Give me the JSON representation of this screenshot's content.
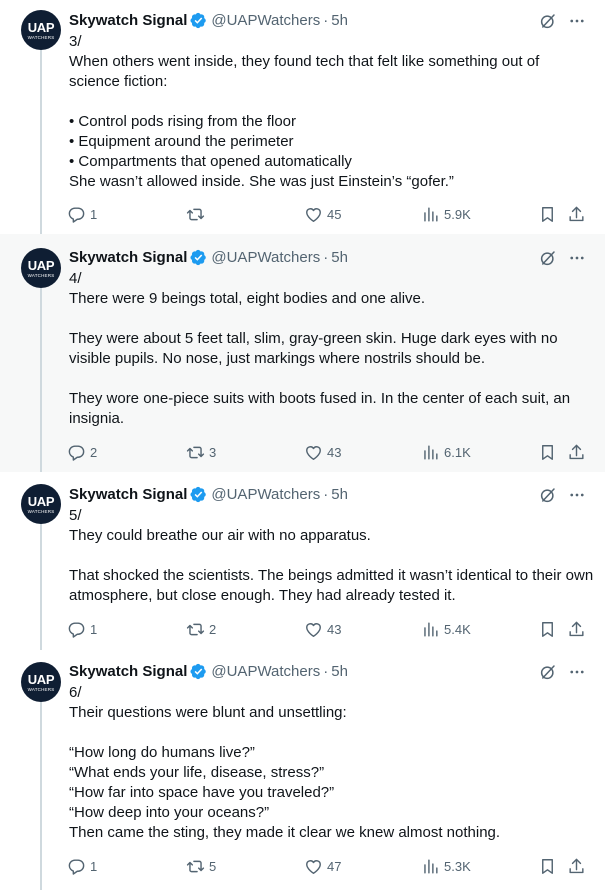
{
  "author": {
    "name": "Skywatch Signal",
    "handle": "@UAPWatchers",
    "separator": "·",
    "avatar_text": "UAP",
    "avatar_subtext": "WATCHERS",
    "verified_icon": "verified-badge-icon"
  },
  "colors": {
    "verified": "#1d9bf0",
    "muted": "#536471",
    "text": "#0f1419",
    "highlight_bg": "#f7f8f8",
    "thread_line": "#cfd9de",
    "avatar_bg": "#0f1e33"
  },
  "tweets": [
    {
      "time": "5h",
      "text": "3/\nWhen others went inside, they found tech that felt like something out of science fiction:\n\n• Control pods rising from the floor\n• Equipment around the perimeter\n• Compartments that opened automatically\nShe wasn’t allowed inside. She was just Einstein’s “gofer.”",
      "replies": "1",
      "reposts": "",
      "likes": "45",
      "views": "5.9K"
    },
    {
      "time": "5h",
      "text": "4/\nThere were 9 beings total, eight bodies and one alive.\n\nThey were about 5 feet tall, slim, gray-green skin. Huge dark eyes with no visible pupils. No nose, just markings where nostrils should be.\n\nThey wore one-piece suits with boots fused in. In the center of each suit, an insignia.",
      "replies": "2",
      "reposts": "3",
      "likes": "43",
      "views": "6.1K"
    },
    {
      "time": "5h",
      "text": "5/\nThey could breathe our air with no apparatus.\n\nThat shocked the scientists. The beings admitted it wasn’t identical to their own atmosphere, but close enough. They had already tested it.",
      "replies": "1",
      "reposts": "2",
      "likes": "43",
      "views": "5.4K"
    },
    {
      "time": "5h",
      "text": "6/\nTheir questions were blunt and unsettling:\n\n“How long do humans live?”\n“What ends your life, disease, stress?”\n“How far into space have you traveled?”\n“How deep into your oceans?”\nThen came the sting, they made it clear we knew almost nothing.",
      "replies": "1",
      "reposts": "5",
      "likes": "47",
      "views": "5.3K"
    }
  ]
}
